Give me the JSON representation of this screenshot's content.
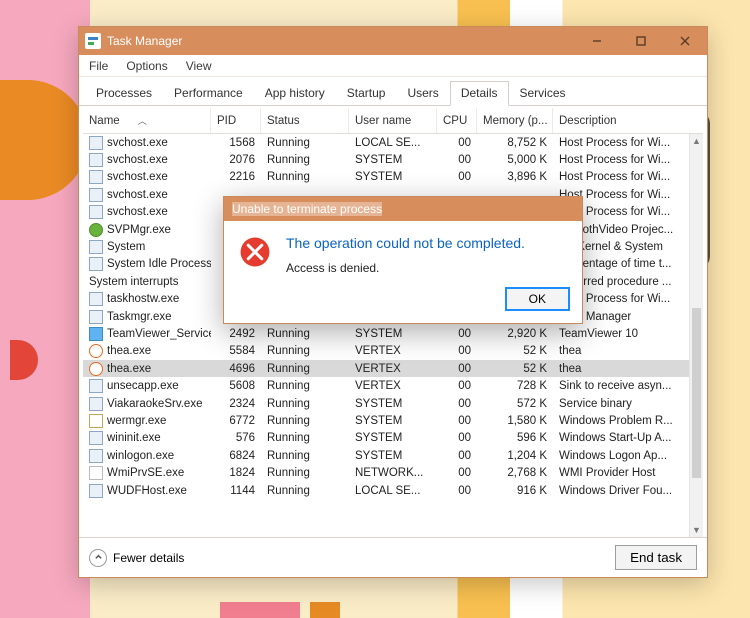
{
  "window": {
    "title": "Task Manager",
    "menu": {
      "file": "File",
      "options": "Options",
      "view": "View"
    },
    "tabs": {
      "processes": "Processes",
      "performance": "Performance",
      "app_history": "App history",
      "startup": "Startup",
      "users": "Users",
      "details": "Details",
      "services": "Services"
    },
    "columns": {
      "name": "Name",
      "pid": "PID",
      "status": "Status",
      "user": "User name",
      "cpu": "CPU",
      "mem": "Memory (p...",
      "desc": "Description"
    },
    "footer": {
      "fewer": "Fewer details",
      "endtask": "End task"
    }
  },
  "dialog": {
    "title": "Unable to terminate process",
    "heading": "The operation could not be completed.",
    "body": "Access is denied.",
    "ok": "OK"
  },
  "rows": [
    {
      "icon": "exe",
      "name": "svchost.exe",
      "pid": "1568",
      "status": "Running",
      "user": "LOCAL SE...",
      "cpu": "00",
      "mem": "8,752 K",
      "desc": "Host Process for Wi..."
    },
    {
      "icon": "exe",
      "name": "svchost.exe",
      "pid": "2076",
      "status": "Running",
      "user": "SYSTEM",
      "cpu": "00",
      "mem": "5,000 K",
      "desc": "Host Process for Wi..."
    },
    {
      "icon": "exe",
      "name": "svchost.exe",
      "pid": "2216",
      "status": "Running",
      "user": "SYSTEM",
      "cpu": "00",
      "mem": "3,896 K",
      "desc": "Host Process for Wi..."
    },
    {
      "icon": "exe",
      "name": "svchost.exe",
      "pid": "",
      "status": "",
      "user": "",
      "cpu": "",
      "mem": "",
      "desc": "Host Process for Wi..."
    },
    {
      "icon": "exe",
      "name": "svchost.exe",
      "pid": "",
      "status": "",
      "user": "",
      "cpu": "",
      "mem": "",
      "desc": "Host Process for Wi..."
    },
    {
      "icon": "svp",
      "name": "SVPMgr.exe",
      "pid": "",
      "status": "",
      "user": "",
      "cpu": "",
      "mem": "",
      "desc": "SmoothVideo Projec..."
    },
    {
      "icon": "exe",
      "name": "System",
      "pid": "",
      "status": "",
      "user": "",
      "cpu": "",
      "mem": "",
      "desc": "NT Kernel & System"
    },
    {
      "icon": "exe",
      "name": "System Idle Process",
      "pid": "",
      "status": "",
      "user": "",
      "cpu": "",
      "mem": "",
      "desc": "Percentage of time t..."
    },
    {
      "icon": "none",
      "name": "System interrupts",
      "pid": "",
      "status": "",
      "user": "",
      "cpu": "",
      "mem": "",
      "desc": "Deferred procedure ..."
    },
    {
      "icon": "exe",
      "name": "taskhostw.exe",
      "pid": "",
      "status": "",
      "user": "",
      "cpu": "",
      "mem": "",
      "desc": "Host Process for Wi..."
    },
    {
      "icon": "exe",
      "name": "Taskmgr.exe",
      "pid": "",
      "status": "",
      "user": "",
      "cpu": "",
      "mem": "",
      "desc": "Task Manager"
    },
    {
      "icon": "tv",
      "name": "TeamViewer_Service...",
      "pid": "2492",
      "status": "Running",
      "user": "SYSTEM",
      "cpu": "00",
      "mem": "2,920 K",
      "desc": "TeamViewer 10"
    },
    {
      "icon": "thea",
      "name": "thea.exe",
      "pid": "5584",
      "status": "Running",
      "user": "VERTEX",
      "cpu": "00",
      "mem": "52 K",
      "desc": "thea"
    },
    {
      "icon": "thea",
      "name": "thea.exe",
      "pid": "4696",
      "status": "Running",
      "user": "VERTEX",
      "cpu": "00",
      "mem": "52 K",
      "desc": "thea",
      "selected": true
    },
    {
      "icon": "exe",
      "name": "unsecapp.exe",
      "pid": "5608",
      "status": "Running",
      "user": "VERTEX",
      "cpu": "00",
      "mem": "728 K",
      "desc": "Sink to receive asyn..."
    },
    {
      "icon": "exe",
      "name": "ViakaraokeSrv.exe",
      "pid": "2324",
      "status": "Running",
      "user": "SYSTEM",
      "cpu": "00",
      "mem": "572 K",
      "desc": "Service binary"
    },
    {
      "icon": "boot",
      "name": "wermgr.exe",
      "pid": "6772",
      "status": "Running",
      "user": "SYSTEM",
      "cpu": "00",
      "mem": "1,580 K",
      "desc": "Windows Problem R..."
    },
    {
      "icon": "exe",
      "name": "wininit.exe",
      "pid": "576",
      "status": "Running",
      "user": "SYSTEM",
      "cpu": "00",
      "mem": "596 K",
      "desc": "Windows Start-Up A..."
    },
    {
      "icon": "exe",
      "name": "winlogon.exe",
      "pid": "6824",
      "status": "Running",
      "user": "SYSTEM",
      "cpu": "00",
      "mem": "1,204 K",
      "desc": "Windows Logon Ap..."
    },
    {
      "icon": "wmi",
      "name": "WmiPrvSE.exe",
      "pid": "1824",
      "status": "Running",
      "user": "NETWORK...",
      "cpu": "00",
      "mem": "2,768 K",
      "desc": "WMI Provider Host"
    },
    {
      "icon": "exe",
      "name": "WUDFHost.exe",
      "pid": "1144",
      "status": "Running",
      "user": "LOCAL SE...",
      "cpu": "00",
      "mem": "916 K",
      "desc": "Windows Driver Fou..."
    }
  ]
}
